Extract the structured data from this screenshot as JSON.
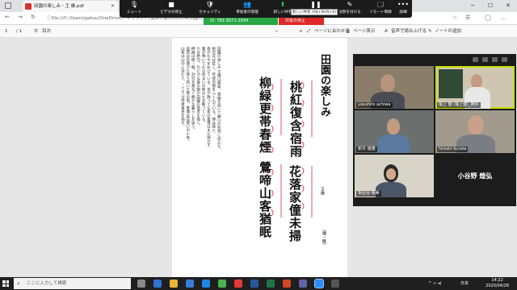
{
  "browser": {
    "tab_title": "田園の楽しみ・王 維.pdf",
    "tab_close": "✕",
    "url": "file:///C:/Users/gakuu/OneDrive/ドキュメント/漢詩の会/2020/04/田園の楽しみ_王維.pdf",
    "window_min": "─",
    "window_max": "☐",
    "window_close": "✕"
  },
  "zoom_toolbar": {
    "buttons": [
      {
        "icon": "🎙",
        "label": "ミュート"
      },
      {
        "icon": "■",
        "label": "ビデオの停止"
      },
      {
        "icon": "🛡",
        "label": "セキュリティ"
      },
      {
        "icon": "👥",
        "label": "参加者の管理"
      },
      {
        "icon": "⬆",
        "label": "新しい共有"
      },
      {
        "icon": "❚❚",
        "label": "共有の一時停止"
      },
      {
        "icon": "✎",
        "label": "注釈を付ける"
      },
      {
        "icon": "🗔",
        "label": "リモート制御"
      },
      {
        "icon": "•••",
        "label": "詳細"
      }
    ],
    "tooltip": "新しい共有 (Alt+Shift+S)",
    "meeting_id": "ID: 781-8271-1934",
    "stop_share": "共有の停止"
  },
  "pdf_toolbar": {
    "page_current": "1",
    "page_total": "/ 1",
    "toc": "目次",
    "zoom_out": "−",
    "zoom_in": "+",
    "fit_page": "ページに合わせる",
    "page_view": "ページ表示",
    "read_aloud": "音声で読み上げる",
    "add_note": "ノートの追加"
  },
  "document": {
    "title": "田園の楽しみ",
    "poem_lines": [
      "桃紅復含宿雨",
      "柳緑更帯春煙",
      "花落家僮未掃",
      "鶯啼山客猶眠"
    ],
    "prose_lines": [
      "田園の楽しみ 王維は晩年、官職を退いて輞川の別荘に住んだ。",
      "桃の花は紅く、昨夜の雨をふくんでいる。柳は緑に、",
      "春のもやをおびている。花が散っても家の童僕はまだ掃かず、",
      "鶯が鳴いても山住まいの客はなお眠っている。",
      "六言絶句。のどかな春の朝の田園の情景を描く。",
      "押韻は煙・眠。対句を重ねて静かな暮らしを詠う。",
      "宿雨は前夜から降り続いた雨の意。家僮は召使いの少年。",
      "山客は山中に住む人、ここでは作者自身を指す。"
    ],
    "side_note_1": "王維",
    "side_note_2": "〔煙・眠〕"
  },
  "gallery": {
    "participants": [
      {
        "name": "yasuhito achiwa",
        "active": false
      },
      {
        "name": "檀上 健 (檀上健)_横浜",
        "active": true
      },
      {
        "name": "新井 雄雅",
        "active": false
      },
      {
        "name": "hiroshi kurata",
        "active": false
      },
      {
        "name": "相合谷 晴美",
        "active": false
      },
      {
        "name": "小谷野 煌弘",
        "active": false
      }
    ]
  },
  "taskbar": {
    "search_placeholder": "ここに入力して検索",
    "ime": "日本",
    "time": "14:22",
    "date": "2020/04/28"
  }
}
